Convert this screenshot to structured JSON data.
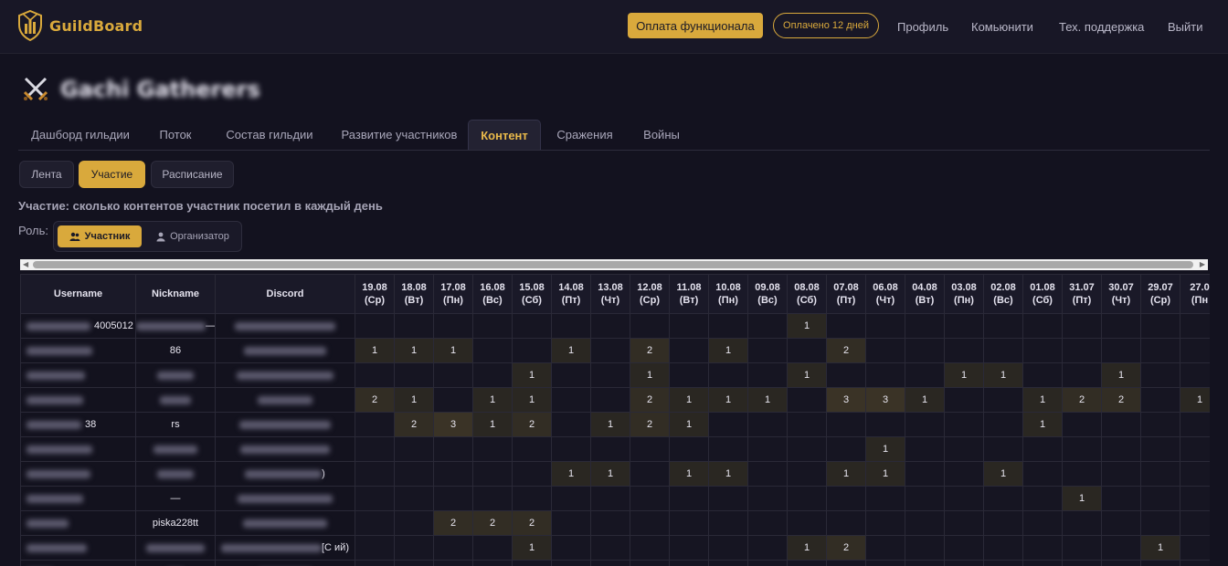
{
  "header": {
    "logo_text": "GuildBoard",
    "pay_button": "Оплата функционала",
    "paid_badge": "Оплачено 12 дней",
    "nav": [
      "Профиль",
      "Комьюнити",
      "Тех. поддержка",
      "Выйти"
    ]
  },
  "guild": {
    "name": "Gachi Gatherers"
  },
  "tabs": [
    "Дашборд гильдии",
    "Поток",
    "Состав гильдии",
    "Развитие участников",
    "Контент",
    "Сражения",
    "Войны"
  ],
  "active_tab": "Контент",
  "subtabs": [
    "Лента",
    "Участие",
    "Расписание"
  ],
  "active_subtab": "Участие",
  "description": "Участие: сколько контентов участник посетил в каждый день",
  "role": {
    "label": "Роль:",
    "options": [
      "Участник",
      "Организатор"
    ],
    "selected": "Участник"
  },
  "table": {
    "fixed_headers": [
      "Username",
      "Nickname",
      "Discord"
    ],
    "dates": [
      [
        "19.08",
        "(Ср)"
      ],
      [
        "18.08",
        "(Вт)"
      ],
      [
        "17.08",
        "(Пн)"
      ],
      [
        "16.08",
        "(Вс)"
      ],
      [
        "15.08",
        "(Сб)"
      ],
      [
        "14.08",
        "(Пт)"
      ],
      [
        "13.08",
        "(Чт)"
      ],
      [
        "12.08",
        "(Ср)"
      ],
      [
        "11.08",
        "(Вт)"
      ],
      [
        "10.08",
        "(Пн)"
      ],
      [
        "09.08",
        "(Вс)"
      ],
      [
        "08.08",
        "(Сб)"
      ],
      [
        "07.08",
        "(Пт)"
      ],
      [
        "06.08",
        "(Чт)"
      ],
      [
        "04.08",
        "(Вт)"
      ],
      [
        "03.08",
        "(Пн)"
      ],
      [
        "02.08",
        "(Вс)"
      ],
      [
        "01.08",
        "(Сб)"
      ],
      [
        "31.07",
        "(Пт)"
      ],
      [
        "30.07",
        "(Чт)"
      ],
      [
        "29.07",
        "(Ср)"
      ],
      [
        "27.0",
        "(Пн"
      ]
    ],
    "rows": [
      {
        "username": "4005012",
        "nickname": "—",
        "discord": "",
        "values": [
          0,
          0,
          0,
          0,
          0,
          0,
          0,
          0,
          0,
          0,
          0,
          1,
          0,
          0,
          0,
          0,
          0,
          0,
          0,
          0,
          0,
          0
        ]
      },
      {
        "username": "",
        "nickname": "86",
        "discord": "",
        "values": [
          1,
          1,
          1,
          0,
          0,
          1,
          0,
          2,
          0,
          1,
          0,
          0,
          2,
          0,
          0,
          0,
          0,
          0,
          0,
          0,
          0,
          0
        ]
      },
      {
        "username": "",
        "nickname": "",
        "discord": "",
        "values": [
          0,
          0,
          0,
          0,
          1,
          0,
          0,
          1,
          0,
          0,
          0,
          1,
          0,
          0,
          0,
          1,
          1,
          0,
          0,
          1,
          0,
          0
        ]
      },
      {
        "username": "",
        "nickname": "",
        "discord": "",
        "values": [
          2,
          1,
          0,
          1,
          1,
          0,
          0,
          2,
          1,
          1,
          1,
          0,
          3,
          3,
          1,
          0,
          0,
          1,
          2,
          2,
          0,
          1
        ]
      },
      {
        "username": "38",
        "nickname": "rs",
        "discord": "",
        "values": [
          0,
          2,
          3,
          1,
          2,
          0,
          1,
          2,
          1,
          0,
          0,
          0,
          0,
          0,
          0,
          0,
          0,
          1,
          0,
          0,
          0,
          0
        ]
      },
      {
        "username": "",
        "nickname": "",
        "discord": "",
        "values": [
          0,
          0,
          0,
          0,
          0,
          0,
          0,
          0,
          0,
          0,
          0,
          0,
          0,
          1,
          0,
          0,
          0,
          0,
          0,
          0,
          0,
          0
        ]
      },
      {
        "username": "",
        "nickname": "",
        "discord": ")",
        "values": [
          0,
          0,
          0,
          0,
          0,
          1,
          1,
          0,
          1,
          1,
          0,
          0,
          1,
          1,
          0,
          0,
          1,
          0,
          0,
          0,
          0,
          0
        ]
      },
      {
        "username": "",
        "nickname": "—",
        "discord": "",
        "values": [
          0,
          0,
          0,
          0,
          0,
          0,
          0,
          0,
          0,
          0,
          0,
          0,
          0,
          0,
          0,
          0,
          0,
          0,
          1,
          0,
          0,
          0
        ]
      },
      {
        "username": "",
        "nickname": "piska228tt",
        "discord": "",
        "values": [
          0,
          0,
          2,
          2,
          2,
          0,
          0,
          0,
          0,
          0,
          0,
          0,
          0,
          0,
          0,
          0,
          0,
          0,
          0,
          0,
          0,
          0
        ]
      },
      {
        "username": "",
        "nickname": "",
        "discord": "[С                    ий)",
        "values": [
          0,
          0,
          0,
          0,
          1,
          0,
          0,
          0,
          0,
          0,
          0,
          1,
          2,
          0,
          0,
          0,
          0,
          0,
          0,
          0,
          1,
          0
        ]
      },
      {
        "username": "",
        "nickname": "",
        "discord": "",
        "values": [
          0,
          0,
          0,
          0,
          0,
          0,
          0,
          0,
          0,
          0,
          0,
          0,
          0,
          0,
          0,
          0,
          0,
          0,
          0,
          0,
          0,
          0
        ]
      }
    ]
  }
}
